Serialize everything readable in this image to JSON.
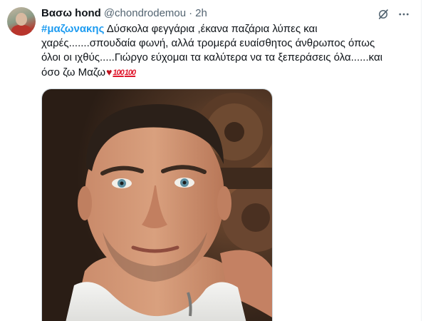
{
  "tweet": {
    "author": {
      "display_name": "Βασω hond",
      "handle": "@chondrodemou"
    },
    "separator": "·",
    "timestamp": "2h",
    "text": {
      "hashtag": "#μαζωνακης",
      "line1": " Δύσκολα φεγγάρια ,έκανα παζάρια λύπες και",
      "line2": "χαρές.......σπουδαία φωνή, αλλά τρομερά ευαίσθητος άνθρωπος όπως",
      "line3": "όλοι οι ιχθύς.....Γιώργο εύχομαι τα καλύτερα να τα ξεπεράσεις όλα......και",
      "line4": "όσο ζω Μαζω",
      "emoji_heart": "♥",
      "emoji_100a": "100",
      "emoji_100b": "100"
    },
    "icons": {
      "grok": "grok-icon",
      "more": "more-options-icon"
    },
    "colors": {
      "link": "#1d9bf0",
      "text": "#0f1419",
      "secondary": "#536471"
    }
  }
}
